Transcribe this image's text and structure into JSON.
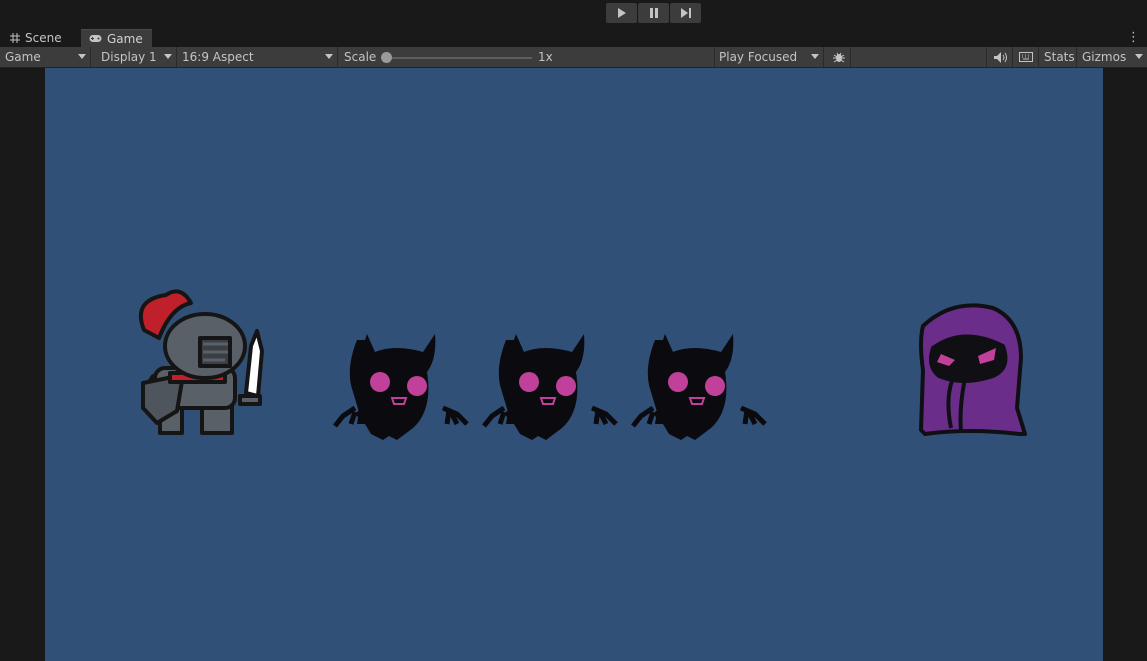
{
  "tabs": [
    {
      "label": "Scene",
      "icon": "grid-icon",
      "active": false
    },
    {
      "label": "Game",
      "icon": "gamepad-icon",
      "active": true
    }
  ],
  "playbar": {
    "play": "play-icon",
    "pause": "pause-icon",
    "step": "step-icon"
  },
  "toolbar": {
    "view_mode": "Game",
    "display": "Display 1",
    "aspect": "16:9 Aspect",
    "scale_label": "Scale",
    "scale_value": "1x",
    "play_mode": "Play Focused",
    "stats": "Stats",
    "gizmos": "Gizmos"
  },
  "game": {
    "background": "#315078",
    "characters": [
      "knight",
      "imp",
      "imp",
      "imp",
      "hooded-mage"
    ]
  }
}
